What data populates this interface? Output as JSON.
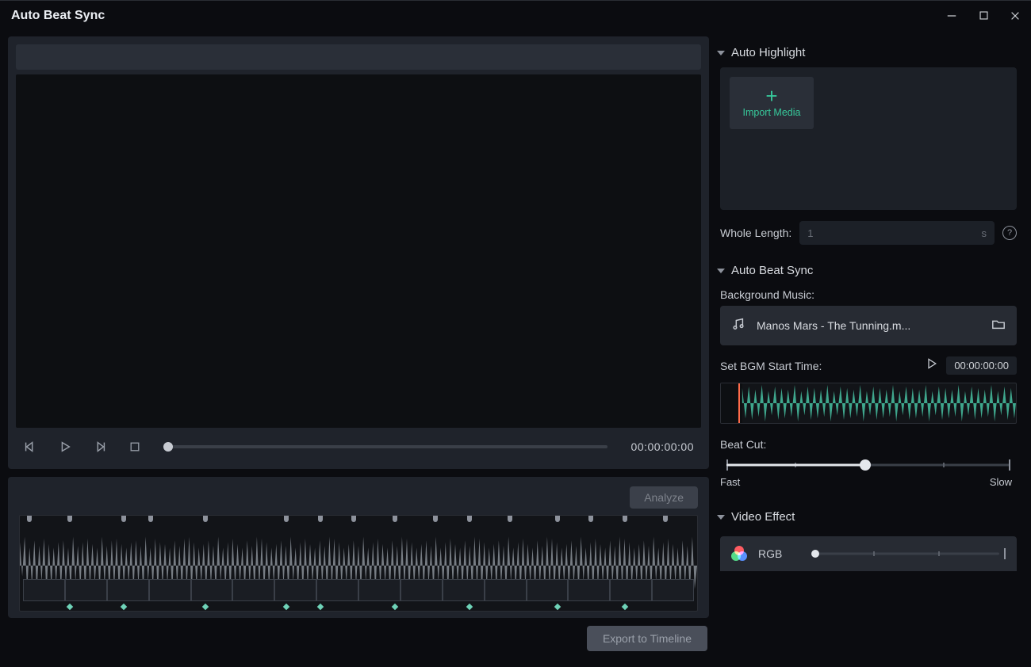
{
  "window": {
    "title": "Auto Beat Sync"
  },
  "transport": {
    "timecode": "00:00:00:00"
  },
  "beats_panel": {
    "analyze_label": "Analyze"
  },
  "export_label": "Export to Timeline",
  "sidebar": {
    "auto_highlight": {
      "heading": "Auto Highlight",
      "import_label": "Import Media",
      "whole_length_label": "Whole Length:",
      "whole_length_value": "1",
      "whole_length_unit": "s"
    },
    "auto_beat_sync": {
      "heading": "Auto Beat Sync",
      "bgm_label": "Background Music:",
      "bgm_track": "Manos Mars - The Tunning.m...",
      "start_time_label": "Set BGM Start Time:",
      "start_time_value": "00:00:00:00",
      "beat_cut_label": "Beat Cut:",
      "fast_label": "Fast",
      "slow_label": "Slow"
    },
    "video_effect": {
      "heading": "Video Effect",
      "item0_label": "RGB"
    }
  }
}
